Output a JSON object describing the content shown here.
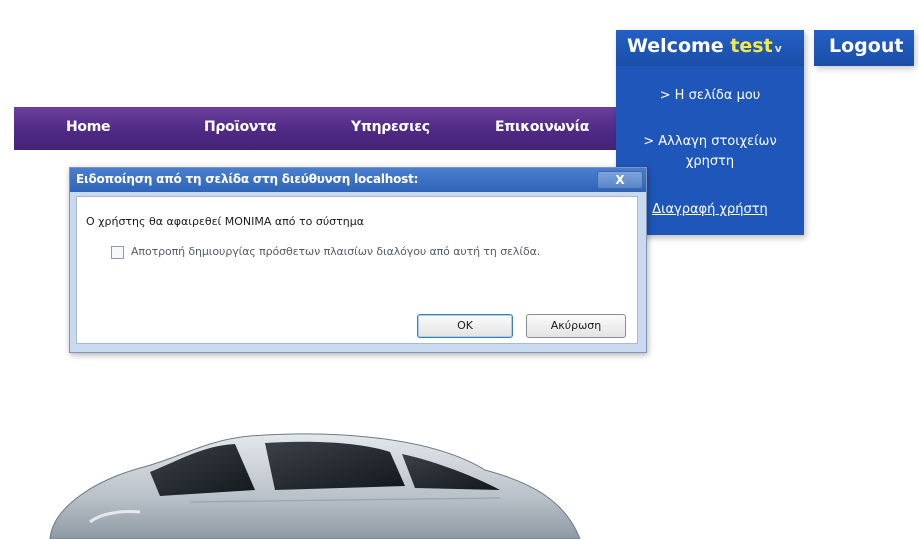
{
  "nav": {
    "items": [
      {
        "label": "Home"
      },
      {
        "label": "Προϊοντα"
      },
      {
        "label": "Υπηρεσιες"
      },
      {
        "label": "Επικοινωνία"
      }
    ],
    "background_color": "#4f2a86"
  },
  "user_menu": {
    "welcome_prefix": "Welcome ",
    "username": "test",
    "caret": "v",
    "items": [
      {
        "label": "> Η σελίδα μου"
      },
      {
        "label": "> Αλλαγη στοιχείων"
      },
      {
        "label": "χρηστη"
      },
      {
        "label": "Διαγραφή χρήστη"
      }
    ],
    "background_color": "#1f56b9",
    "username_color": "#f6e84a"
  },
  "logout": {
    "label": "Logout"
  },
  "dialog": {
    "title": "Ειδοποίηση από τη σελίδα στη διεύθυνση localhost:",
    "close_label": "X",
    "message": "Ο χρήστης θα αφαιρεθεί ΜΟΝΙΜΑ από το σύστημα",
    "checkbox_label": "Αποτροπή δημιουργίας πρόσθετων πλαισίων διαλόγου από αυτή τη σελίδα.",
    "checkbox_checked": false,
    "ok_label": "OK",
    "cancel_label": "Ακύρωση"
  },
  "icons": {
    "car": "car-image"
  }
}
